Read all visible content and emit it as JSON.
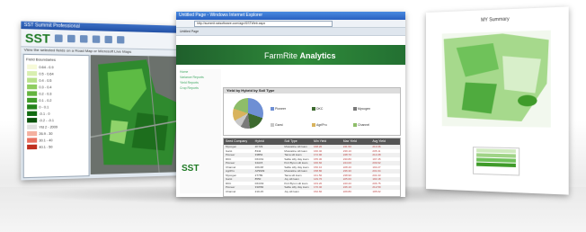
{
  "left_window": {
    "title": "SST Summit Professional",
    "app_logo": "SST",
    "subtitle": "View the selected fields on a Road Map or Microsoft Live Maps",
    "legend_title": "Field Boundaries",
    "legend_colors": [
      "#f6f9d8",
      "#d8efb0",
      "#b7e08a",
      "#8fcd61",
      "#64b43f",
      "#3f9b2a",
      "#24831b",
      "#126b12",
      "#0a520c",
      "#e0e0e0",
      "#f4b0a0",
      "#e87060",
      "#c03020"
    ],
    "legend_rows": [
      "0.64 - 0.9",
      "0.5 - 0.64",
      "0.4 - 0.5",
      "0.3 - 0.4",
      "0.2 - 0.3",
      "0.1 - 0.2",
      "0 - 0.1",
      "-0.1 - 0",
      "-0.2 - -0.1",
      "Yld 2 - 2009",
      "26.9 - 30",
      "30.1 - 40",
      "40.1 - 50"
    ],
    "colors": {
      "titlebar": "#2452a6",
      "brand": "#1f7a25"
    }
  },
  "center_window": {
    "title": "Untitled Page - Windows Internet Explorer",
    "address": "http://summit.sstsoftware.com/agx/SSTWeb.aspx",
    "tabs": "Untitled Page",
    "brand_main": "FarmRite",
    "brand_second": "Analytics",
    "side_nav": [
      "Home",
      "Variance Reports",
      "Yield Reports",
      "Crop Reports"
    ],
    "side_logo": "SST",
    "panel_title": "Yield by Hybrid by Soil Type",
    "pie_legend": [
      {
        "label": "Pioneer",
        "color": "#6e8fd4"
      },
      {
        "label": "DKC",
        "color": "#3d6a2f"
      },
      {
        "label": "Mycogen",
        "color": "#7a7a7a"
      },
      {
        "label": "Garst",
        "color": "#c8c8c8"
      },
      {
        "label": "AgriPro",
        "color": "#d8b35d"
      },
      {
        "label": "Channel",
        "color": "#8ebd69"
      }
    ],
    "table_headers": [
      "Seed Company",
      "Hybrid",
      "Soil Type",
      "Min Yield",
      "Max Yield",
      "Avg Yield"
    ],
    "table_rows": [
      [
        "Mycogen",
        "2K729",
        "Muscatine silt loam",
        "168.20",
        "241.50",
        "210.36"
      ],
      [
        "Garst",
        "8342",
        "Muscatine silt loam",
        "160.40",
        "239.10",
        "205.11"
      ],
      [
        "Pioneer",
        "33B54",
        "Tama silt loam",
        "172.90",
        "248.70",
        "214.08"
      ],
      [
        "DKC",
        "DKC61",
        "Sable silty clay loam",
        "155.30",
        "230.80",
        "197.45"
      ],
      [
        "Pioneer",
        "34A15",
        "Port Byron silt loam",
        "166.60",
        "244.00",
        "209.92"
      ],
      [
        "Channel",
        "209-68",
        "Sable silty clay loam",
        "150.10",
        "228.40",
        "193.27"
      ],
      [
        "AgriPro",
        "AP9909",
        "Muscatine silt loam",
        "158.80",
        "236.30",
        "201.64"
      ],
      [
        "Mycogen",
        "2T789",
        "Tama silt loam",
        "161.50",
        "238.90",
        "204.33"
      ],
      [
        "Garst",
        "8550",
        "Joy silt loam",
        "149.70",
        "225.60",
        "190.18"
      ],
      [
        "DKC",
        "DKC63",
        "Port Byron silt loam",
        "163.20",
        "240.20",
        "206.75"
      ],
      [
        "Pioneer",
        "33W84",
        "Sable silty clay loam",
        "170.40",
        "246.10",
        "212.59"
      ],
      [
        "Channel",
        "210-15",
        "Joy silt loam",
        "152.60",
        "229.80",
        "195.02"
      ]
    ],
    "colors": {
      "banner": "#2f8a3a",
      "titlebar": "#2960c0"
    }
  },
  "right_window": {
    "title": "MY Summary"
  }
}
